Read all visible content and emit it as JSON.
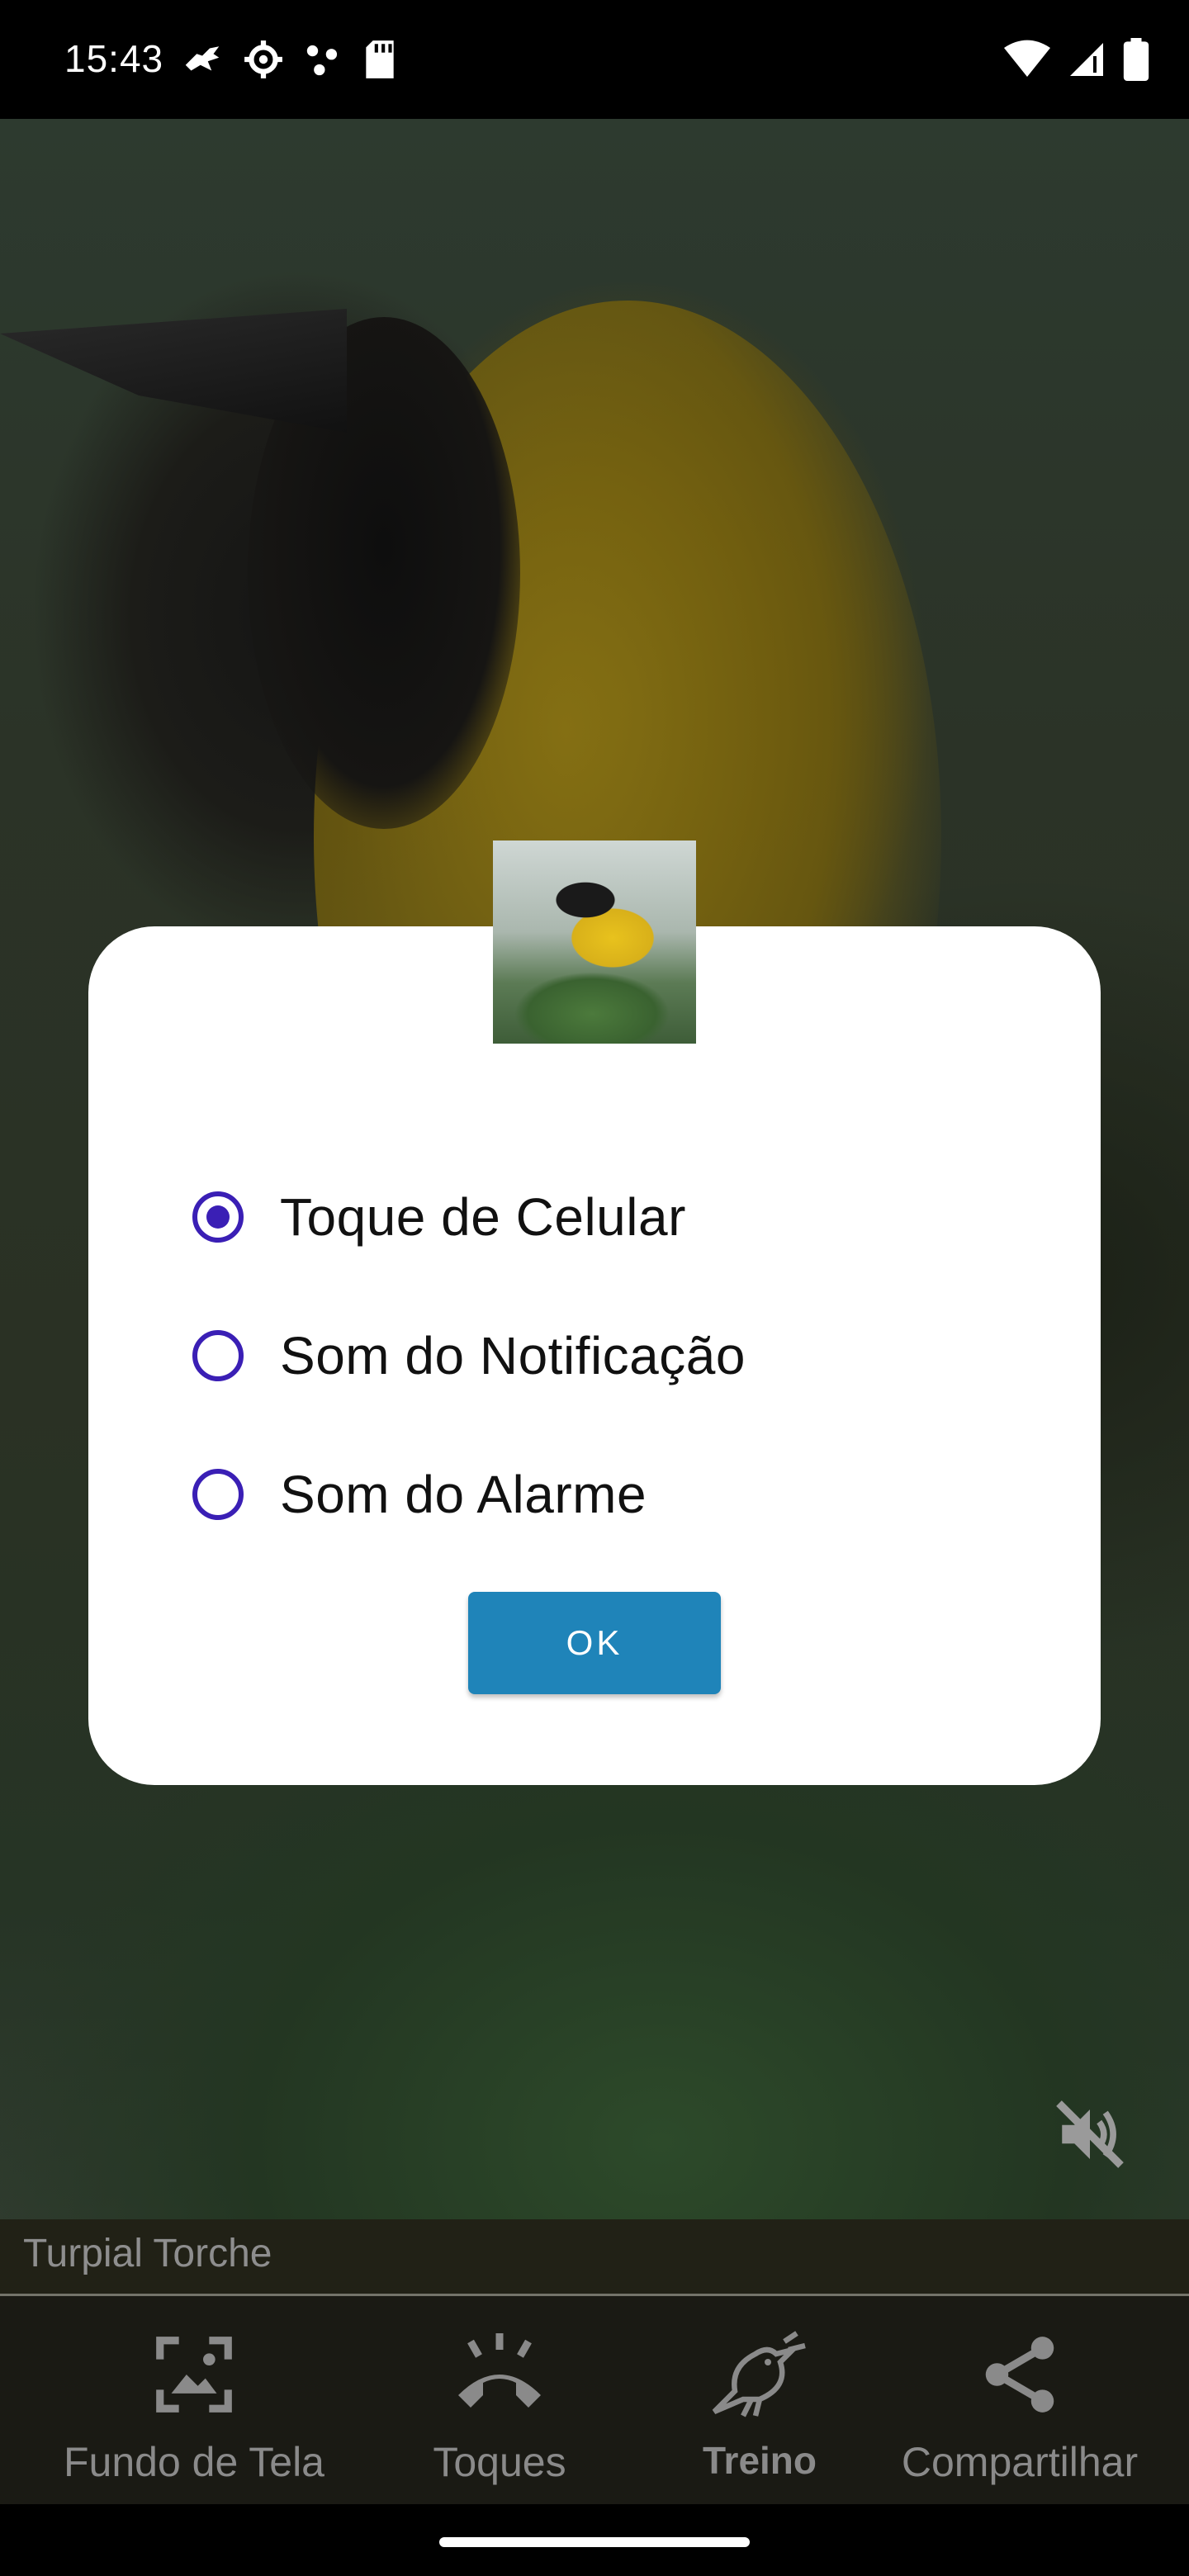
{
  "status_bar": {
    "time": "15:43",
    "left_icons": [
      "bird-notification-icon",
      "settings-notification-icon",
      "dots-notification-icon",
      "sdcard-icon"
    ],
    "right_icons": [
      "wifi-icon",
      "signal-icon",
      "battery-icon"
    ]
  },
  "dialog": {
    "options": [
      {
        "label": "Toque de Celular",
        "checked": true
      },
      {
        "label": "Som do Notificação",
        "checked": false
      },
      {
        "label": "Som do Alarme",
        "checked": false
      }
    ],
    "ok_label": "OK"
  },
  "bird_name": "Turpial Torche",
  "nav": {
    "items": [
      {
        "label": "Fundo de Tela",
        "icon": "wallpaper-icon"
      },
      {
        "label": "Toques",
        "icon": "ringtone-icon"
      },
      {
        "label": "Treino",
        "icon": "bird-icon"
      },
      {
        "label": "Compartilhar",
        "icon": "share-icon"
      }
    ]
  },
  "colors": {
    "accent": "#3a1fb5",
    "ok_button": "#1f84b9"
  }
}
